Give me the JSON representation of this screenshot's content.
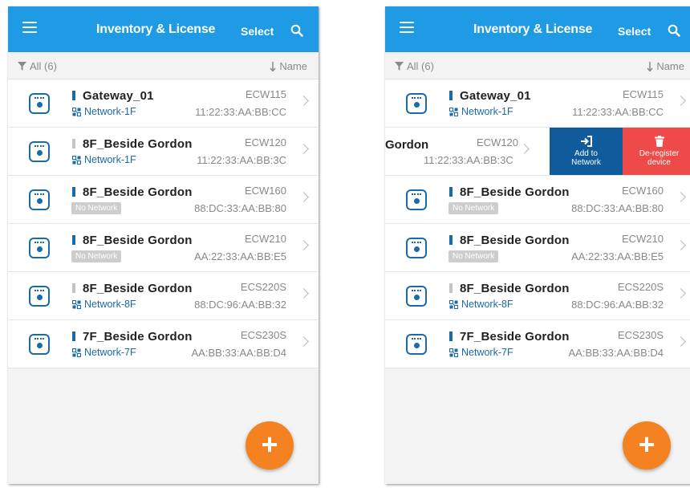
{
  "appbar": {
    "title": "Inventory & License",
    "select_label": "Select"
  },
  "filterbar": {
    "filter_label": "All (6)",
    "sort_label": "Name"
  },
  "devices": [
    {
      "name": "Gateway_01",
      "flag": "blue",
      "network": "Network-1F",
      "model": "ECW115",
      "mac": "11:22:33:AA:BB:CC"
    },
    {
      "name": "8F_Beside Gordon",
      "flag": "grey",
      "network": "Network-1F",
      "model": "ECW120",
      "mac": "11:22:33:AA:BB:3C"
    },
    {
      "name": "8F_Beside Gordon",
      "flag": "blue",
      "network": "No Network",
      "model": "ECW160",
      "mac": "88:DC:33:AA:BB:80"
    },
    {
      "name": "8F_Beside Gordon",
      "flag": "blue",
      "network": "No Network",
      "model": "ECW210",
      "mac": "AA:22:33:AA:BB:E5"
    },
    {
      "name": "8F_Beside Gordon",
      "flag": "grey",
      "network": "Network-8F",
      "model": "ECS220S",
      "mac": "88:DC:96:AA:BB:32"
    },
    {
      "name": "7F_Beside Gordon",
      "flag": "blue",
      "network": "Network-7F",
      "model": "ECS230S",
      "mac": "AA:BB:33:AA:BB:D4"
    }
  ],
  "swiped_row": {
    "name_fragment": "Gordon",
    "model": "ECW120",
    "mac": "11:22:33:AA:BB:3C"
  },
  "actions": {
    "add_label_1": "Add to",
    "add_label_2": "Network",
    "dereg_label_1": "De-register",
    "dereg_label_2": "device"
  },
  "fab": {
    "label": "+"
  },
  "colors": {
    "appbar": "#1e9be4",
    "accent": "#1b6aa3",
    "fab": "#f58220",
    "add_action": "#0f5b9c",
    "dereg_action": "#ee4a4a"
  },
  "icons": {
    "menu": "hamburger-icon",
    "search": "search-icon",
    "filter": "funnel-icon",
    "sort": "sort-arrow-icon",
    "device": "access-point-icon",
    "network": "network-icon",
    "chevron": "chevron-right-icon",
    "add_network": "login-arrow-icon",
    "deregister": "trash-icon"
  }
}
